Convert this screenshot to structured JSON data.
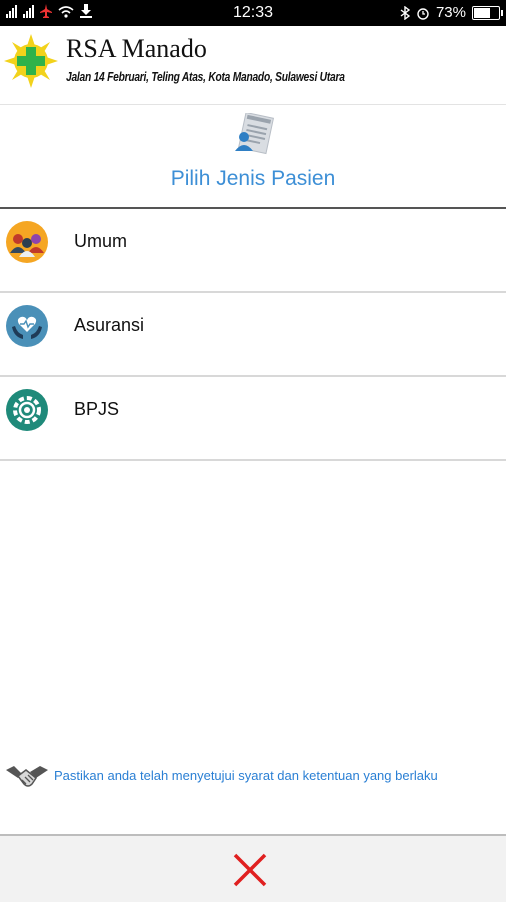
{
  "status_bar": {
    "time": "12:33",
    "battery": "73%",
    "battery_level": 0.73
  },
  "header": {
    "title": "RSA Manado",
    "address": "Jalan 14 Februari, Teling Atas, Kota Manado, Sulawesi Utara",
    "logo_icon": "hospital-cross-sun-logo"
  },
  "page": {
    "title": "Pilih Jenis Pasien",
    "icon": "patient-form-icon",
    "accent": "#3d8fd6"
  },
  "patient_types": [
    {
      "label": "Umum",
      "icon": "people-group-icon",
      "color": "#f5a623"
    },
    {
      "label": "Asuransi",
      "icon": "heart-hands-icon",
      "color": "#4a90b8"
    },
    {
      "label": "BPJS",
      "icon": "gear-shield-icon",
      "color": "#1f8a7a"
    }
  ],
  "terms": {
    "text": "Pastikan anda telah menyetujui syarat dan ketentuan yang berlaku",
    "icon": "handshake-icon"
  },
  "footer": {
    "close_icon": "close-icon",
    "close_color": "#e02020"
  }
}
